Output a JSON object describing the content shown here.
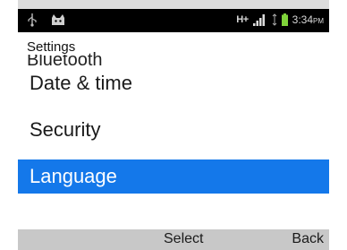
{
  "status_bar": {
    "left_icons": [
      "usb-icon",
      "android-icon"
    ],
    "network": "H+",
    "right_icons": [
      "signal-icon",
      "sync-icon",
      "battery-icon"
    ],
    "time": "3:34",
    "ampm": "PM"
  },
  "header": {
    "title": "Settings"
  },
  "menu": {
    "partial_item": "Bluetooth",
    "items": [
      {
        "label": "Date & time",
        "selected": false
      },
      {
        "label": "Security",
        "selected": false
      },
      {
        "label": "Language",
        "selected": true
      }
    ]
  },
  "softkeys": {
    "center": "Select",
    "right": "Back"
  },
  "colors": {
    "selection": "#1478ea",
    "softkey_bar": "#c8c8c8",
    "status_bar": "#000000"
  }
}
